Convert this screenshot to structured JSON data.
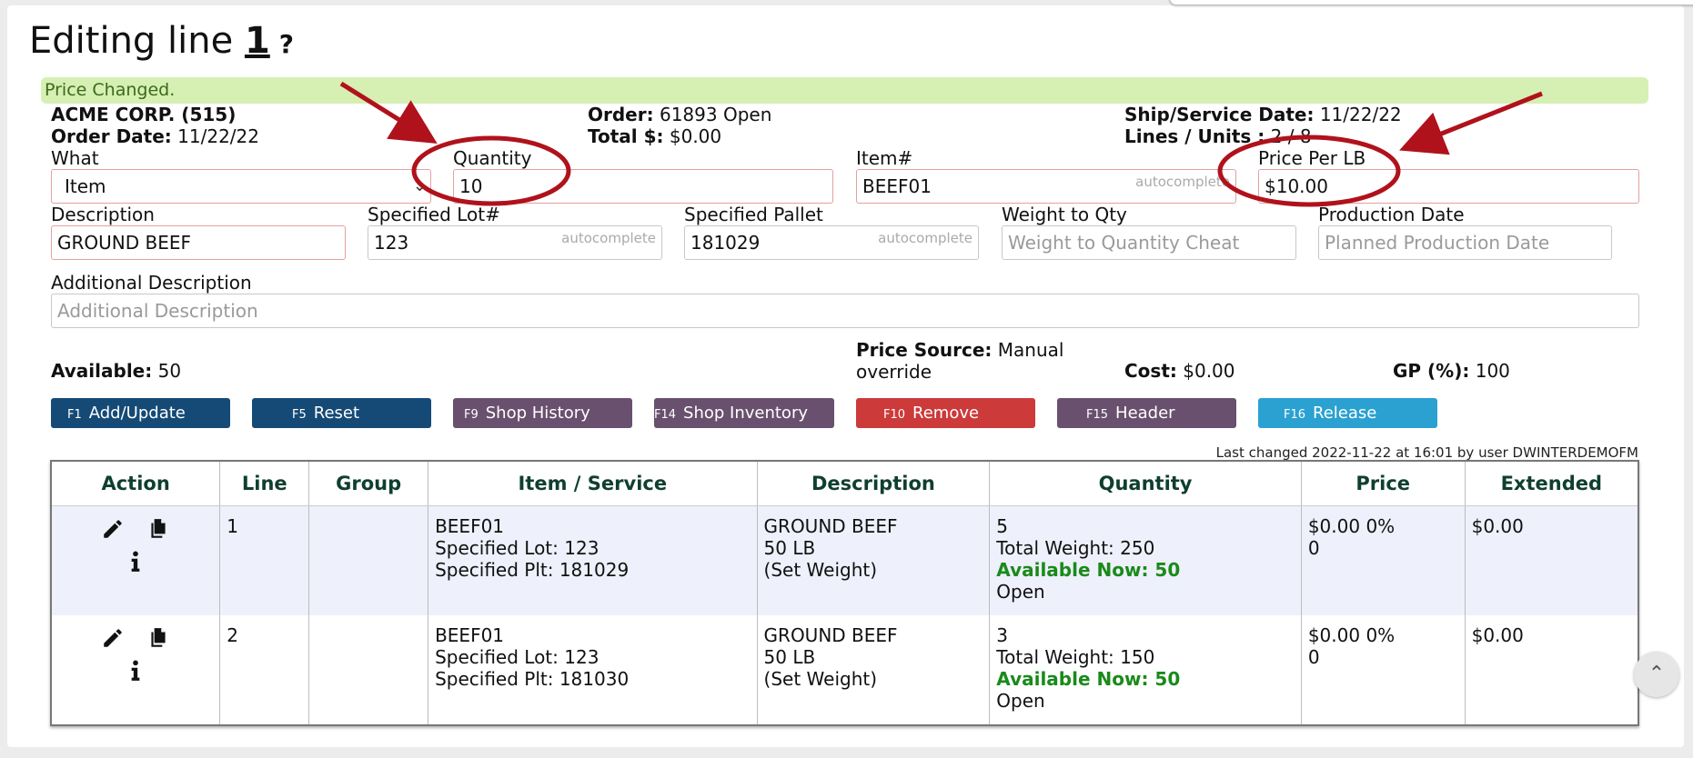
{
  "title": {
    "prefix": "Editing line",
    "line_number": "1",
    "help": "?"
  },
  "alert": "Price Changed.",
  "header": {
    "customer": "ACME CORP. (515)",
    "order_date_label": "Order Date:",
    "order_date": "11/22/22",
    "order_label": "Order:",
    "order": "61893 Open",
    "total_label": "Total $:",
    "total": "$0.00",
    "ship_label": "Ship/Service Date:",
    "ship_date": "11/22/22",
    "lines_label": "Lines / Units :",
    "lines": "2 / 8"
  },
  "form": {
    "what_label": "What",
    "what_value": "Item",
    "quantity_label": "Quantity",
    "quantity_value": "10",
    "item_label": "Item#",
    "item_value": "BEEF01",
    "autocomplete": "autocomplete",
    "price_label": "Price Per LB",
    "price_value": "$10.00",
    "description_label": "Description",
    "description_value": "GROUND BEEF",
    "lot_label": "Specified Lot#",
    "lot_value": "123",
    "pallet_label": "Specified Pallet",
    "pallet_value": "181029",
    "weight_label": "Weight to Qty",
    "weight_placeholder": "Weight to Quantity Cheat",
    "production_label": "Production Date",
    "production_placeholder": "Planned Production Date",
    "addl_label": "Additional Description",
    "addl_placeholder": "Additional Description"
  },
  "summary": {
    "available_label": "Available:",
    "available": "50",
    "price_source_label": "Price Source:",
    "price_source_1": "Manual",
    "price_source_2": "override",
    "cost_label": "Cost:",
    "cost": "$0.00",
    "gp_label": "GP (%):",
    "gp": "100"
  },
  "buttons": [
    {
      "key": "F1",
      "label": "Add/Update"
    },
    {
      "key": "F5",
      "label": "Reset"
    },
    {
      "key": "F9",
      "label": "Shop History"
    },
    {
      "key": "F14",
      "label": "Shop Inventory"
    },
    {
      "key": "F10",
      "label": "Remove"
    },
    {
      "key": "F15",
      "label": "Header"
    },
    {
      "key": "F16",
      "label": "Release"
    }
  ],
  "last_changed": "Last changed 2022-11-22 at 16:01 by user DWINTERDEMOFM",
  "table": {
    "headers": [
      "Action",
      "Line",
      "Group",
      "Item / Service",
      "Description",
      "Quantity",
      "Price",
      "Extended"
    ],
    "rows": [
      {
        "line": "1",
        "group": "",
        "item": "BEEF01",
        "lot": "Specified Lot: 123",
        "plt": "Specified Plt: 181029",
        "desc": "GROUND BEEF",
        "desc2": "50 LB",
        "desc3": "(Set Weight)",
        "qty": "5",
        "weight": "Total Weight: 250",
        "avail": "Available Now: 50",
        "status": "Open",
        "price": "$0.00 0%",
        "price2": "0",
        "extended": "$0.00"
      },
      {
        "line": "2",
        "group": "",
        "item": "BEEF01",
        "lot": "Specified Lot: 123",
        "plt": "Specified Plt: 181030",
        "desc": "GROUND BEEF",
        "desc2": "50 LB",
        "desc3": "(Set Weight)",
        "qty": "3",
        "weight": "Total Weight: 150",
        "avail": "Available Now: 50",
        "status": "Open",
        "price": "$0.00 0%",
        "price2": "0",
        "extended": "$0.00"
      }
    ]
  },
  "colors": {
    "alert_bg": "#d6efb3",
    "navy": "#154a76",
    "purple": "#6a506f",
    "red": "#cc3a3a",
    "teal": "#2aa1d1",
    "annotation": "#b0121b"
  }
}
